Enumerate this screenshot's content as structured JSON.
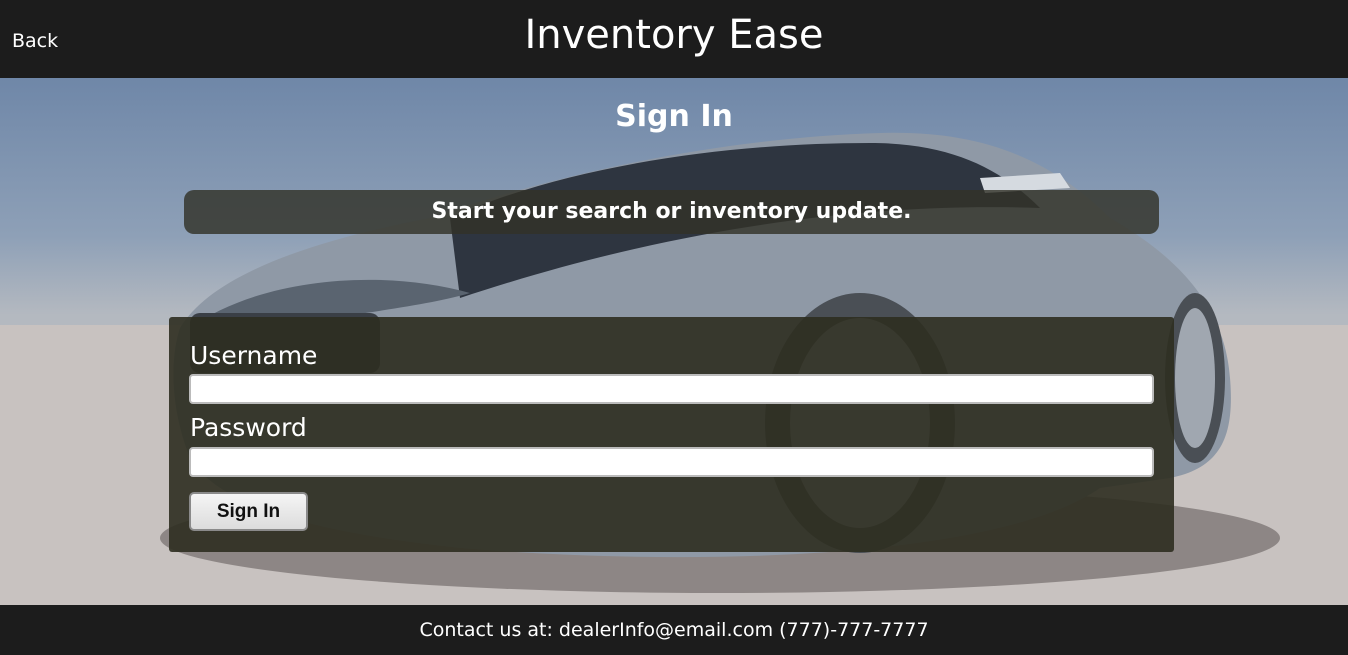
{
  "header": {
    "back_label": "Back",
    "title": "Inventory Ease"
  },
  "main": {
    "heading": "Sign In",
    "tagline": "Start your search or inventory update."
  },
  "form": {
    "username_label": "Username",
    "username_value": "",
    "password_label": "Password",
    "password_value": "",
    "submit_label": "Sign In"
  },
  "footer": {
    "contact_text": "Contact us at: dealerInfo@email.com (777)-777-7777"
  },
  "colors": {
    "bar": "#1c1c1c",
    "panel": "#2d2d20",
    "sky": "#6f87a8"
  }
}
